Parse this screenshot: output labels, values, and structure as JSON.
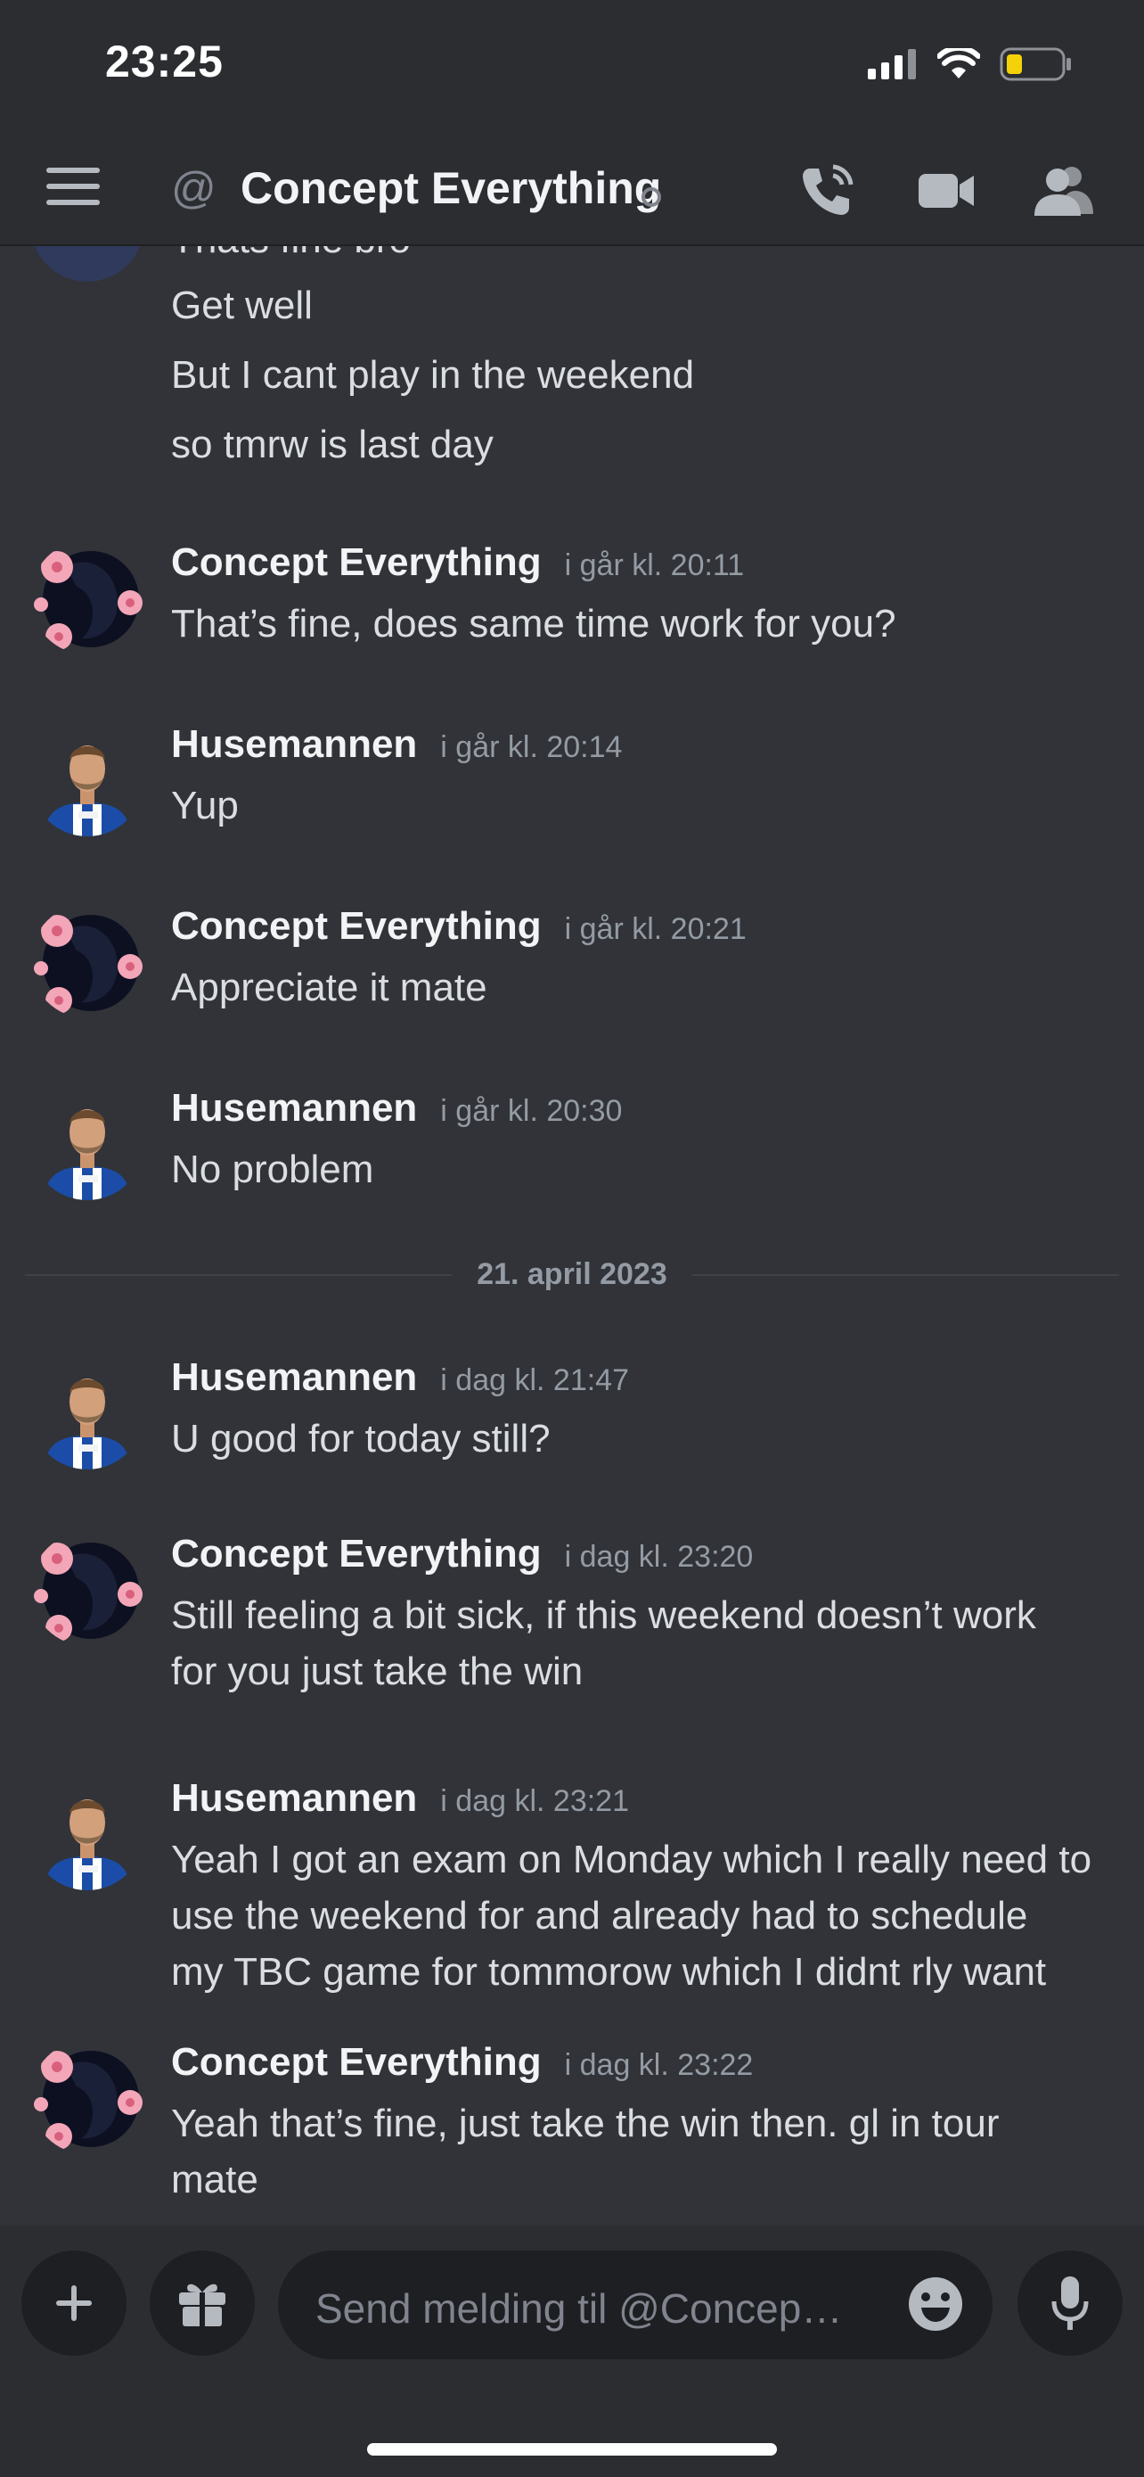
{
  "status_bar": {
    "time": "23:25"
  },
  "header": {
    "at_symbol": "@",
    "title": "Concept Everything"
  },
  "chat": {
    "continuation": [
      {
        "text": "Thats fine bro"
      },
      {
        "text": "Get well"
      },
      {
        "text": "But I cant play in the weekend"
      },
      {
        "text": "so tmrw is last day"
      }
    ],
    "messages": [
      {
        "author": "Concept Everything",
        "time": "i går kl. 20:11",
        "lines": [
          "That’s fine, does same time work for you?"
        ]
      },
      {
        "author": "Husemannen",
        "time": "i går kl. 20:14",
        "lines": [
          "Yup"
        ]
      },
      {
        "author": "Concept Everything",
        "time": "i går kl. 20:21",
        "lines": [
          "Appreciate it mate"
        ]
      },
      {
        "author": "Husemannen",
        "time": "i går kl. 20:30",
        "lines": [
          "No problem"
        ]
      },
      {
        "author": "Husemannen",
        "time": "i dag kl. 21:47",
        "lines": [
          "U good for today still?"
        ]
      },
      {
        "author": "Concept Everything",
        "time": "i dag kl. 23:20",
        "lines": [
          "Still feeling a bit sick, if this weekend doesn’t work",
          "for you just take the win"
        ]
      },
      {
        "author": "Husemannen",
        "time": "i dag kl. 23:21",
        "lines": [
          "Yeah I got an exam on Monday which I really need to",
          "use the weekend for and already had to schedule",
          "my TBC game for tommorow which I didnt rly want"
        ]
      },
      {
        "author": "Concept Everything",
        "time": "i dag kl. 23:22",
        "lines": [
          "Yeah that’s fine, just take the win then. gl in tour",
          "mate"
        ]
      }
    ],
    "date_divider": "21. april 2023"
  },
  "composer": {
    "placeholder": "Send melding til @Concept Ev..."
  },
  "colors": {
    "background": "#313338",
    "bar": "#2b2d31",
    "input": "#1e1f22"
  },
  "icons": {
    "header": [
      "menu-icon",
      "call-icon",
      "video-icon",
      "members-icon"
    ],
    "composer": [
      "plus-icon",
      "gift-icon",
      "emoji-icon",
      "mic-icon"
    ]
  }
}
